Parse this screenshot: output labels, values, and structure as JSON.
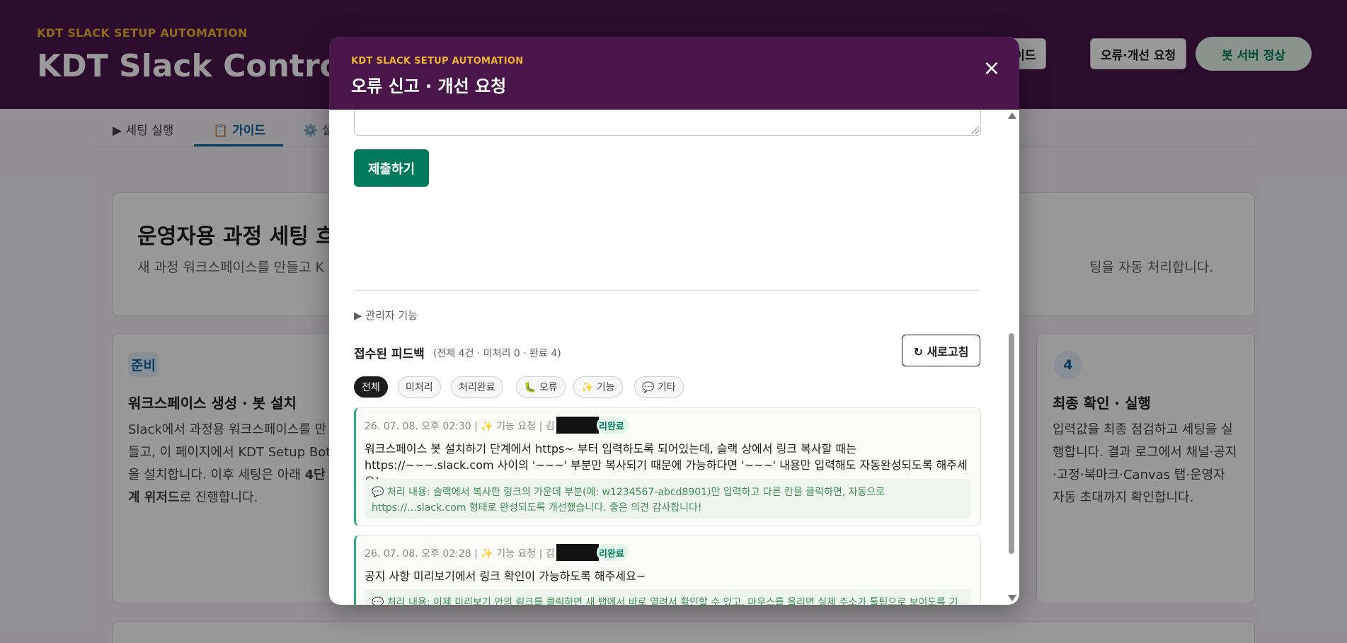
{
  "header": {
    "eyebrow": "KDT SLACK SETUP AUTOMATION",
    "title": "KDT Slack Control To",
    "guide_button": "용 가이드",
    "report_button": "오류·개선 요청",
    "status_label": "봇 서버 정상"
  },
  "tabs": [
    {
      "label": "▶ 세팅 실행"
    },
    {
      "label": "📋 가이드"
    },
    {
      "label": "⚙️ 설"
    }
  ],
  "hero": {
    "title": "운영자용 과정 세팅 흐",
    "desc_left": "새 과정 워크스페이스를 만들고 K",
    "desc_right": "팅을 자동 처리합니다."
  },
  "steps": {
    "left": {
      "badge": "준비",
      "title": "워크스페이스 생성 · 봇 설치",
      "desc_a": "Slack에서 과정용 워크스페이스를 만들고, 이 페이지에서 KDT Setup Bot을 설치합니다. 이후 세팅은 아래 ",
      "desc_b": "4단계 위저드",
      "desc_c": "로 진행합니다."
    },
    "right": {
      "badge": "4",
      "title": "최종 확인 · 실행",
      "desc": "입력값을 최종 점검하고 세팅을 실행합니다. 결과 로그에서 채널·공지·고정·북마크·Canvas 탭·운영자 자동 초대까지 확인합니다."
    }
  },
  "modal": {
    "eyebrow": "KDT SLACK SETUP AUTOMATION",
    "title": "오류 신고 · 개선 요청",
    "close_icon": "×",
    "submit_label": "제출하기",
    "admin_toggle": "▶ 관리자 기능",
    "feedback_title": "접수된 피드백",
    "feedback_summary": "(전체 4건 · 미처리 0 · 완료 4)",
    "refresh_label": "↻ 새로고침",
    "filters": [
      {
        "label": "전체"
      },
      {
        "label": "미처리"
      },
      {
        "label": "처리완료"
      },
      {
        "label": "🐛 오류"
      },
      {
        "label": "✨ 기능"
      },
      {
        "label": "💬 기타"
      }
    ],
    "items": [
      {
        "meta": "26. 07. 08. 오후 02:30 | ✨ 기능 요청 | 김",
        "status": "리완료",
        "text": "워크스페이스 봇 설치하기 단계에서 https~ 부터 입력하도록 되어있는데, 슬랙 상에서 링크 복사할 때는 https://~~~.slack.com 사이의 '~~~' 부분만 복사되기 때문에 가능하다면 '~~~' 내용만 입력해도 자동완성되도록 해주세요!",
        "reply": "💬 처리 내용: 슬랙에서 복사한 링크의 가운데 부분(예: w1234567-abcd8901)만 입력하고 다른 칸을 클릭하면, 자동으로 https://...slack.com 형태로 완성되도록 개선했습니다. 좋은 의견 감사합니다!"
      },
      {
        "meta": "26. 07. 08. 오후 02:28 | ✨ 기능 요청 | 김",
        "status": "리완료",
        "text": "공지 사항 미리보기에서 링크 확인이 가능하도록 해주세요~",
        "reply": "💬 처리 내용: 이제 미리보기 안의 링크를 클릭하면 새 탭에서 바로 열려서 확인할 수 있고, 마우스를 올리면 실제 주소가 툴팁으로 보이도록 기능 구현하였습니다! 좋은 의견 김"
      }
    ]
  }
}
